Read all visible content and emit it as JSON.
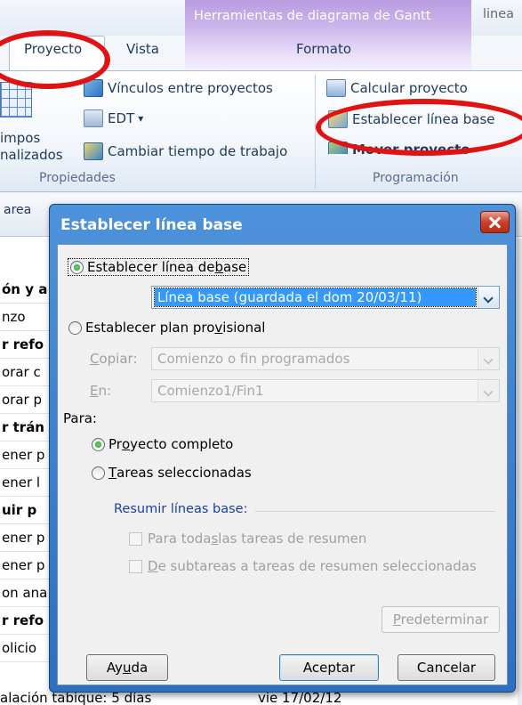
{
  "ribbon": {
    "context_title": "Herramientas de diagrama de Gantt",
    "doc_title_partial": "linea",
    "tabs": [
      "Proyecto",
      "Vista",
      "Formato"
    ],
    "groups": {
      "propiedades": {
        "label": "Propiedades",
        "items": [
          "Vínculos entre proyectos",
          "EDT",
          "Cambiar tiempo de trabajo"
        ],
        "partial_button": [
          "impos",
          "nalizados"
        ]
      },
      "programacion": {
        "label": "Programación",
        "items": [
          "Calcular proyecto",
          "Establecer línea base",
          "Mover proyecto"
        ]
      }
    },
    "edt_dropdown_glyph": "▾"
  },
  "sheet": {
    "header_partial": "area",
    "rows": [
      {
        "text": "ón y a",
        "bold": true
      },
      {
        "text": "nzo",
        "bold": false
      },
      {
        "text": "r refo",
        "bold": true
      },
      {
        "text": "orar c",
        "bold": false
      },
      {
        "text": "orar p",
        "bold": false
      },
      {
        "text": "r trán",
        "bold": true
      },
      {
        "text": "ener p",
        "bold": false
      },
      {
        "text": "ener l",
        "bold": false
      },
      {
        "text": "uir p",
        "bold": true
      },
      {
        "text": "ener p",
        "bold": false
      },
      {
        "text": "ener p",
        "bold": false
      },
      {
        "text": "on ana",
        "bold": false
      },
      {
        "text": "r refo",
        "bold": true
      },
      {
        "text": "olicio",
        "bold": false
      }
    ],
    "bottom_row": {
      "task": "alación tabique: 5 días",
      "date": "vie 17/02/12"
    }
  },
  "dialog": {
    "title": "Establecer línea base",
    "radio_baseline_pre": "Establecer línea de ",
    "radio_baseline_u": "b",
    "radio_baseline_post": "ase",
    "baseline_select_value": "Línea base (guardada el dom 20/03/11)",
    "radio_interim_pre": "Establecer plan pro",
    "radio_interim_u": "v",
    "radio_interim_post": "isional",
    "copy_label_u": "C",
    "copy_label_post": "opiar:",
    "copy_value": "Comienzo o fin programados",
    "into_label_u": "E",
    "into_label_post": "n:",
    "into_value": "Comienzo1/Fin1",
    "for_label": "Para:",
    "for_entire_pre": "Pr",
    "for_entire_u": "o",
    "for_entire_post": "yecto completo",
    "for_selected_u": "T",
    "for_selected_post": "areas seleccionadas",
    "rollup_title": "Resumir líneas base:",
    "rollup_all_pre": "Para toda",
    "rollup_all_u": "s",
    "rollup_all_post": " las tareas de resumen",
    "rollup_sub_u": "D",
    "rollup_sub_post": "e subtareas a tareas de resumen seleccionadas",
    "default_button_u": "P",
    "default_button_post": "redeterminar",
    "help_button_pre": "Ay",
    "help_button_u": "u",
    "help_button_post": "da",
    "ok_button": "Aceptar",
    "cancel_button": "Cancelar"
  },
  "colors": {
    "dialog_title_bar": "#2c6fc3",
    "context_tab": "#cdb8ec",
    "annotation_red": "#e01212",
    "selection_blue": "#3399ff",
    "close_button": "#c9402a"
  },
  "icons": [
    "link-icon",
    "edt-icon",
    "calendar-icon",
    "calculate-icon",
    "baseline-icon",
    "move-project-icon",
    "grid-icon",
    "close-icon",
    "chevron-down-icon"
  ]
}
